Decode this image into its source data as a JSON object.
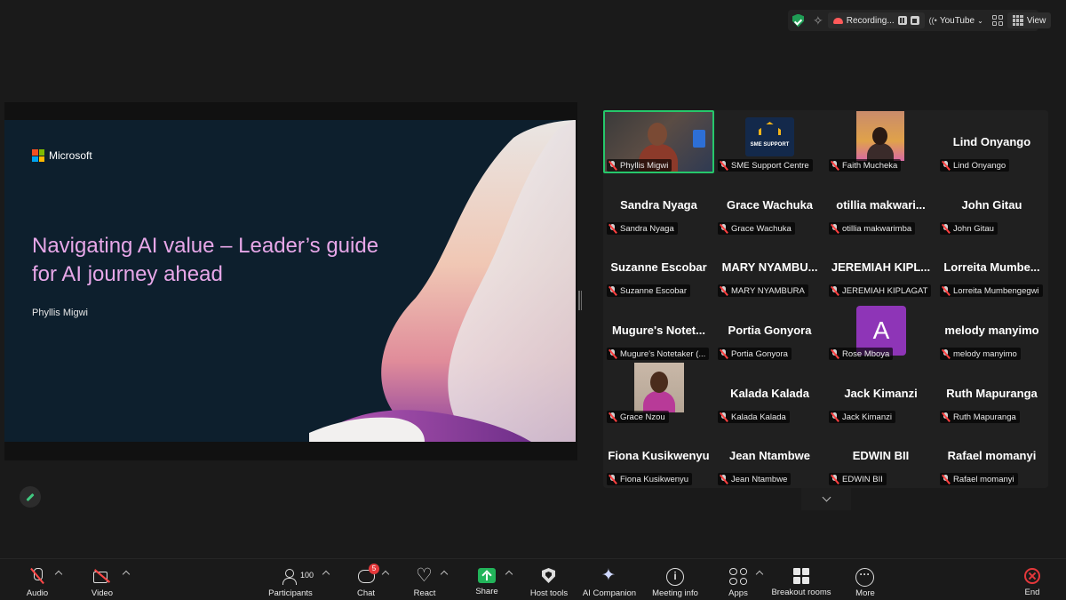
{
  "topbar": {
    "recording_label": "Recording...",
    "livestream_label": "YouTube",
    "view_label": "View"
  },
  "slide": {
    "brand": "Microsoft",
    "title": "Navigating AI value – Leader’s guide for AI journey ahead",
    "presenter": "Phyllis Migwi"
  },
  "gallery": {
    "tiles": [
      {
        "name": "",
        "label": "Phyllis Migwi",
        "type": "video"
      },
      {
        "name": "",
        "label": "SME Support Centre",
        "type": "logo"
      },
      {
        "name": "",
        "label": "Faith Mucheka",
        "type": "video"
      },
      {
        "name": "Lind Onyango",
        "label": "Lind Onyango",
        "type": "name"
      },
      {
        "name": "Sandra Nyaga",
        "label": "Sandra Nyaga",
        "type": "name"
      },
      {
        "name": "Grace Wachuka",
        "label": "Grace Wachuka",
        "type": "name"
      },
      {
        "name": "otillia  makwari...",
        "label": "otillia makwarimba",
        "type": "name"
      },
      {
        "name": "John Gitau",
        "label": "John Gitau",
        "type": "name"
      },
      {
        "name": "Suzanne Escobar",
        "label": "Suzanne Escobar",
        "type": "name"
      },
      {
        "name": "MARY  NYAMBU...",
        "label": "MARY NYAMBURA",
        "type": "name"
      },
      {
        "name": "JEREMIAH  KIPL...",
        "label": "JEREMIAH KIPLAGAT",
        "type": "name"
      },
      {
        "name": "Lorreita  Mumbe...",
        "label": "Lorreita Mumbengegwi",
        "type": "name"
      },
      {
        "name": "Mugure's  Notet...",
        "label": "Mugure's Notetaker (...",
        "type": "name"
      },
      {
        "name": "Portia Gonyora",
        "label": "Portia Gonyora",
        "type": "name"
      },
      {
        "name": "",
        "label": "Rose Mboya",
        "type": "avatar",
        "avatar_letter": "A"
      },
      {
        "name": "melody manyimo",
        "label": "melody manyimo",
        "type": "name"
      },
      {
        "name": "",
        "label": "Grace Nzou",
        "type": "photo"
      },
      {
        "name": "Kalada Kalada",
        "label": "Kalada Kalada",
        "type": "name"
      },
      {
        "name": "Jack Kimanzi",
        "label": "Jack Kimanzi",
        "type": "name"
      },
      {
        "name": "Ruth Mapuranga",
        "label": "Ruth Mapuranga",
        "type": "name"
      },
      {
        "name": "Fiona Kusikwenyu",
        "label": "Fiona Kusikwenyu",
        "type": "name"
      },
      {
        "name": "Jean Ntambwe",
        "label": "Jean Ntambwe",
        "type": "name"
      },
      {
        "name": "EDWIN BII",
        "label": "EDWIN BII",
        "type": "name"
      },
      {
        "name": "Rafael momanyi",
        "label": "Rafael momanyi",
        "type": "name"
      }
    ],
    "sme_logo_text": "SME SUPPORT"
  },
  "toolbar": {
    "audio": "Audio",
    "video": "Video",
    "participants": "Participants",
    "participants_count": "100",
    "chat": "Chat",
    "chat_badge": "5",
    "react": "React",
    "share": "Share",
    "host_tools": "Host tools",
    "ai_companion": "AI Companion",
    "meeting_info": "Meeting info",
    "apps": "Apps",
    "breakout_rooms": "Breakout rooms",
    "more": "More",
    "end": "End"
  },
  "colors": {
    "active_speaker": "#26c76b",
    "slide_title": "#e7a7e8",
    "share_green": "#22b45a",
    "end_red": "#e5383b",
    "avatar_purple": "#8e35b7"
  }
}
